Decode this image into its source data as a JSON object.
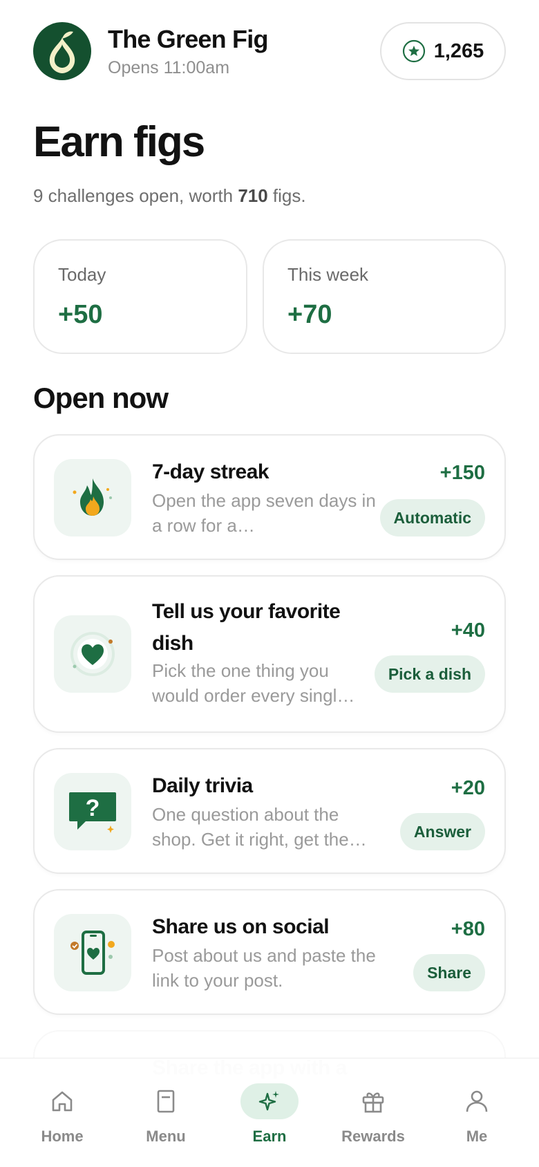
{
  "header": {
    "brand_name": "The Green Fig",
    "hours": "Opens 11:00am",
    "points": "1,265"
  },
  "page": {
    "title": "Earn figs",
    "subtitle_prefix": "9 challenges open, worth ",
    "subtitle_bold": "710",
    "subtitle_suffix": " figs."
  },
  "stats": {
    "today_label": "Today",
    "today_value": "+50",
    "week_label": "This week",
    "week_value": "+70"
  },
  "section": {
    "title": "Open now"
  },
  "challenges": [
    {
      "title": "7-day streak",
      "description": "Open the app seven days in a row for a…",
      "reward": "+150",
      "action": "Automatic",
      "icon": "flame-icon"
    },
    {
      "title": "Tell us your favorite dish",
      "description": "Pick the one thing you would order every singl…",
      "reward": "+40",
      "action": "Pick a dish",
      "icon": "heart-icon"
    },
    {
      "title": "Daily trivia",
      "description": "One question about the shop. Get it right, get the…",
      "reward": "+20",
      "action": "Answer",
      "icon": "question-chat-icon"
    },
    {
      "title": "Share us on social",
      "description": "Post about us and paste the link to your post.",
      "reward": "+80",
      "action": "Share",
      "icon": "phone-heart-icon"
    },
    {
      "title": "Share the app with a",
      "icon": "share-icon"
    }
  ],
  "nav": {
    "items": [
      {
        "label": "Home",
        "icon": "home-icon"
      },
      {
        "label": "Menu",
        "icon": "menu-book-icon"
      },
      {
        "label": "Earn",
        "icon": "sparkle-icon"
      },
      {
        "label": "Rewards",
        "icon": "gift-icon"
      },
      {
        "label": "Me",
        "icon": "person-icon"
      }
    ],
    "active": "Earn"
  },
  "colors": {
    "brand_green": "#1e6e43",
    "dark_green": "#14502f",
    "tile_bg": "#eef5f1",
    "pill_bg": "#e5f1ea",
    "accent_orange": "#f2a81d"
  }
}
